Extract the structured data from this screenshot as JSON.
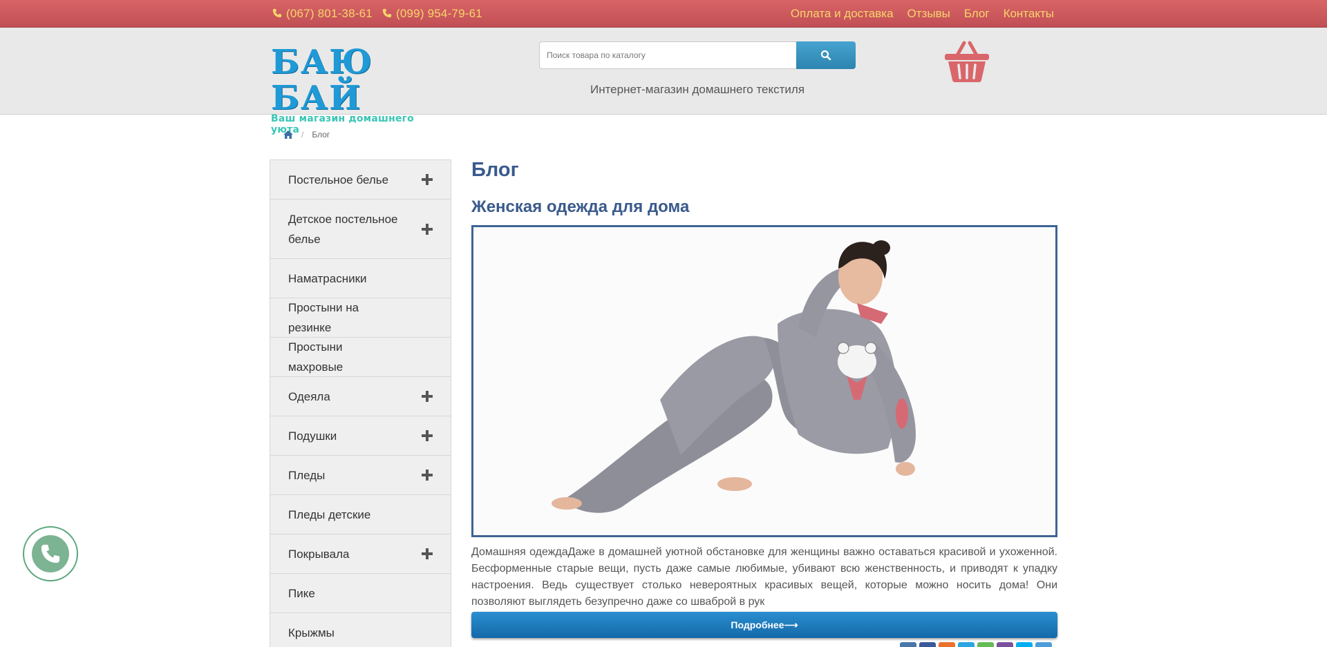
{
  "topbar": {
    "phones": [
      "(067) 801-38-61",
      "(099) 954-79-61"
    ],
    "nav": [
      "Оплата и доставка",
      "Отзывы",
      "Блог",
      "Контакты"
    ],
    "text_color": "#f7d56b",
    "bg_color": "#c95a5d"
  },
  "header": {
    "logo_title": "БАЮ БАЙ",
    "logo_subtitle": "Ваш магазин домашнего уюта",
    "search_placeholder": "Поиск товара по каталогу",
    "tagline": "Интернет-магазин домашнего текстиля"
  },
  "breadcrumb": {
    "current": "Блог"
  },
  "sidebar": {
    "items": [
      {
        "label": "Постельное белье",
        "expandable": true
      },
      {
        "label": "Детское постельное белье",
        "expandable": true
      },
      {
        "label": "Наматрасники",
        "expandable": false
      },
      {
        "label": "Простыни на резинке",
        "expandable": false
      },
      {
        "label": "Простыни махровые",
        "expandable": false
      },
      {
        "label": "Одеяла",
        "expandable": true
      },
      {
        "label": "Подушки",
        "expandable": true
      },
      {
        "label": "Пледы",
        "expandable": true
      },
      {
        "label": "Пледы детские",
        "expandable": false
      },
      {
        "label": "Покрывала",
        "expandable": true
      },
      {
        "label": "Пике",
        "expandable": false
      },
      {
        "label": "Крыжмы",
        "expandable": false
      }
    ]
  },
  "main": {
    "page_title": "Блог",
    "article": {
      "title": "Женская одежда для дома",
      "text": "Домашняя одеждаДаже в домашней уютной обстановке для женщины важно оставаться красивой и ухоженной. Бесформенные старые вещи, пусть даже самые любимые, убивают всю женственность, и приводят к упадку настроения. Ведь существует столько невероятных красивых вещей, которые можно носить дома! Они позволяют выглядеть безупречно даже со шваброй в рук",
      "more_label": "Подробнее⟶"
    }
  },
  "colors": {
    "accent_blue": "#3a5a8c",
    "button_blue": "#1f7dbf",
    "cart_red": "#d9666a"
  }
}
